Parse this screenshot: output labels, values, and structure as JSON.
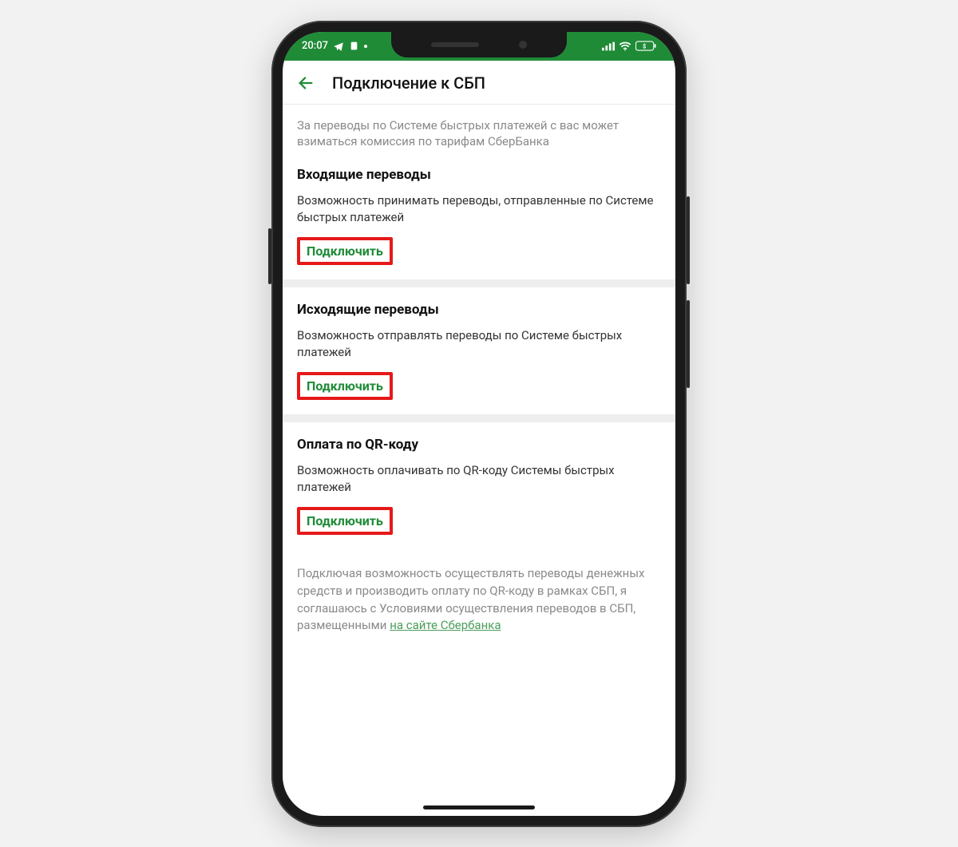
{
  "status": {
    "time": "20:07",
    "icons_left": [
      "telegram-icon",
      "doc-icon",
      "dot-icon"
    ]
  },
  "header": {
    "title": "Подключение к СБП"
  },
  "intro": "За переводы по Системе быстрых платежей с вас может взиматься комиссия по тарифам СберБанка",
  "sections": [
    {
      "title": "Входящие переводы",
      "desc": "Возможность принимать переводы, отправленные по Системе быстрых платежей",
      "button": "Подключить"
    },
    {
      "title": "Исходящие переводы",
      "desc": "Возможность отправлять переводы по Системе быстрых платежей",
      "button": "Подключить"
    },
    {
      "title": "Оплата по QR-коду",
      "desc": "Возможность оплачивать по QR-коду Системы быстрых платежей",
      "button": "Подключить"
    }
  ],
  "footer": {
    "text": "Подключая возможность осуществлять переводы денежных средств и производить оплату по QR-коду в рамках СБП, я соглашаюсь с Условиями осуществления переводов в СБП, размещенными ",
    "link": "на сайте Сбербанка"
  }
}
